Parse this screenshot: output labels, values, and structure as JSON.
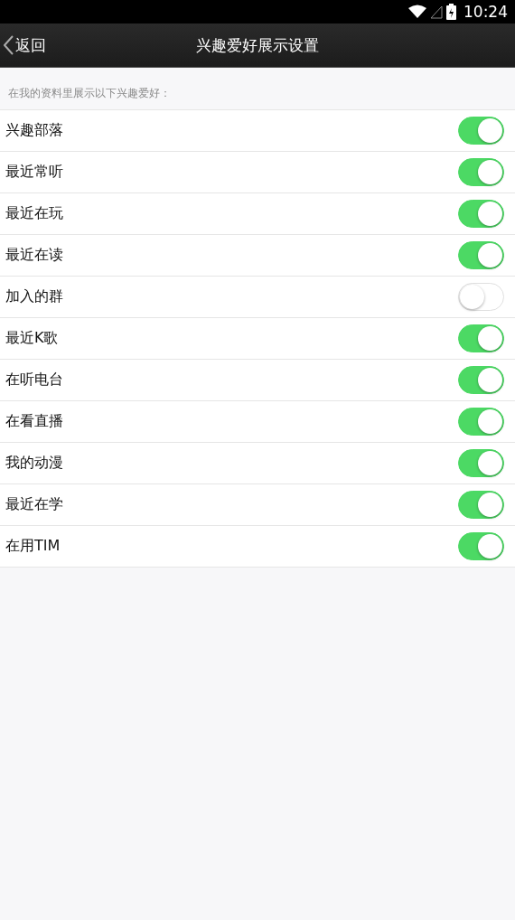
{
  "status_bar": {
    "time": "10:24"
  },
  "header": {
    "back": "返回",
    "title": "兴趣爱好展示设置"
  },
  "section_hint": "在我的资料里展示以下兴趣爱好：",
  "items": [
    {
      "label": "兴趣部落",
      "on": true
    },
    {
      "label": "最近常听",
      "on": true
    },
    {
      "label": "最近在玩",
      "on": true
    },
    {
      "label": "最近在读",
      "on": true
    },
    {
      "label": "加入的群",
      "on": false
    },
    {
      "label": "最近K歌",
      "on": true
    },
    {
      "label": "在听电台",
      "on": true
    },
    {
      "label": "在看直播",
      "on": true
    },
    {
      "label": "我的动漫",
      "on": true
    },
    {
      "label": "最近在学",
      "on": true
    },
    {
      "label": "在用TIM",
      "on": true
    }
  ]
}
